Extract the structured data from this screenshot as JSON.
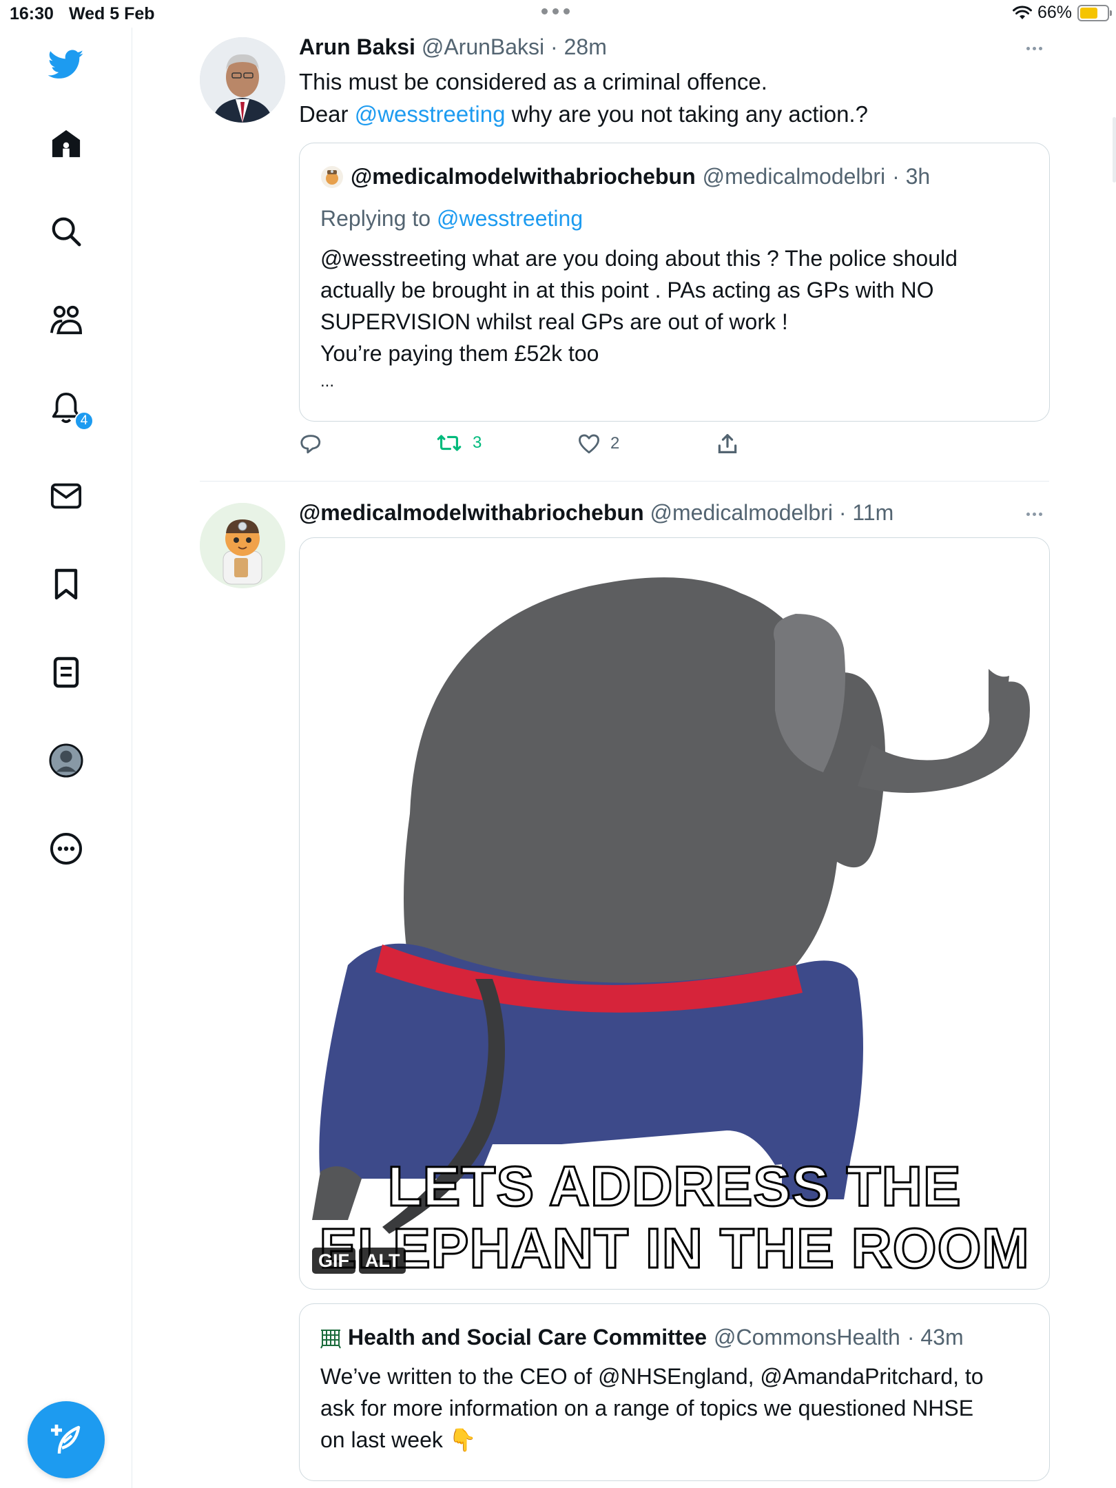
{
  "status_bar": {
    "time": "16:30",
    "date": "Wed 5 Feb",
    "battery": "66%",
    "battery_level": 0.66
  },
  "sidebar": {
    "notifications_badge": "4",
    "items": [
      {
        "name": "twitter-logo-icon"
      },
      {
        "name": "home-icon"
      },
      {
        "name": "search-icon"
      },
      {
        "name": "communities-icon"
      },
      {
        "name": "notifications-icon"
      },
      {
        "name": "messages-icon"
      },
      {
        "name": "bookmarks-icon"
      },
      {
        "name": "lists-icon"
      },
      {
        "name": "profile-icon"
      },
      {
        "name": "more-icon"
      }
    ],
    "compose": "compose-icon"
  },
  "tweet1": {
    "name": "Arun Baksi",
    "handle": "@ArunBaksi",
    "time": "· 28m",
    "line1": "This must be considered as a criminal offence.",
    "line2_prefix": "Dear ",
    "line2_mention": "@wesstreeting",
    "line2_suffix": " why are you not taking any action.?",
    "quoted": {
      "name": "@medicalmodelwithabriochebun",
      "handle": "@medicalmodelbri",
      "time": "· 3h",
      "replying_prefix": "Replying to ",
      "replying_handle": "@wesstreeting",
      "lines": [
        "@wesstreeting what are you doing about this ? The police should",
        "actually be brought in at this point . PAs acting as GPs with NO",
        "SUPERVISION whilst real GPs are out of work !",
        "You’re paying them £52k too",
        "..."
      ]
    },
    "actions": {
      "retweets": "3",
      "likes": "2"
    }
  },
  "tweet2": {
    "name": "@medicalmodelwithabriochebun",
    "handle": "@medicalmodelbri",
    "time": "· 11m",
    "media": {
      "caption_line1": "LETS ADDRESS THE",
      "caption_line2": "ELEPHANT IN THE ROOM",
      "gif_badge": "GIF",
      "alt_badge": "ALT"
    },
    "quoted": {
      "name": "Health and Social Care Committee",
      "handle": "@CommonsHealth",
      "time": "· 43m",
      "lines": [
        "We’ve written to the CEO of @NHSEngland, @AmandaPritchard, to",
        "ask for more information on a range of topics we questioned NHSE",
        "on last week 👇"
      ]
    }
  },
  "colors": {
    "accent": "#1d9bf0",
    "retweet_green": "#00ba7c",
    "text": "#0f1419",
    "muted": "#536471"
  }
}
